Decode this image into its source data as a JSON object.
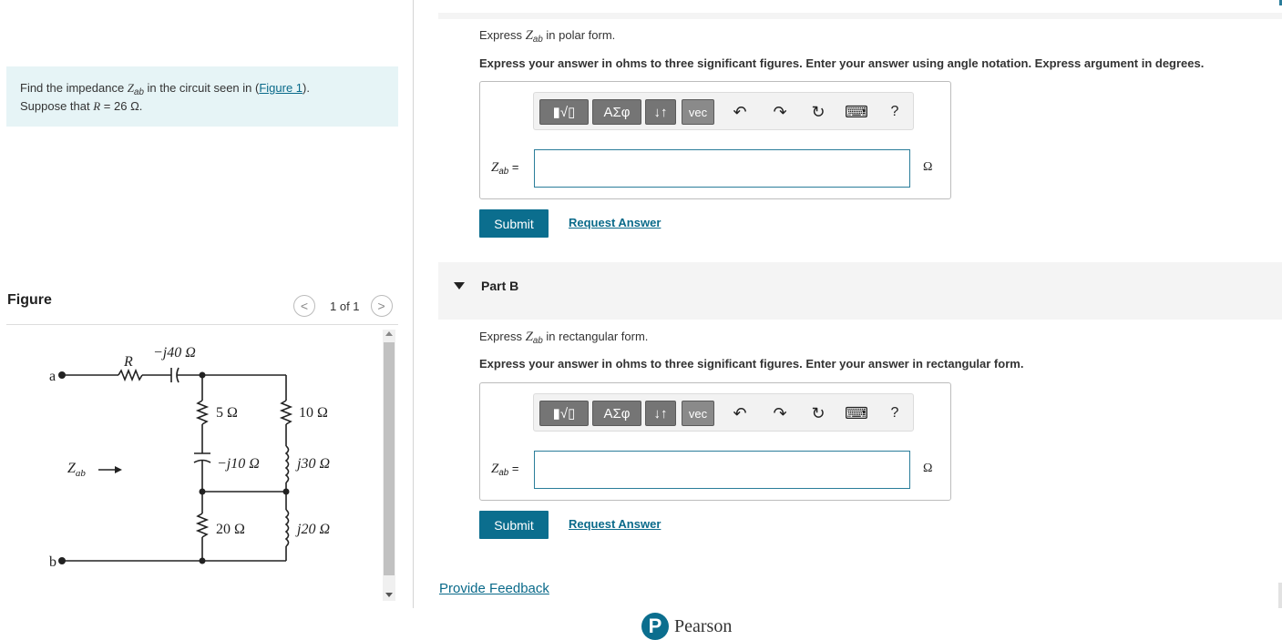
{
  "problem": {
    "text_before": "Find the impedance ",
    "z_symbol": "Z",
    "z_sub": "ab",
    "text_mid": " in the circuit seen in (",
    "figure_link": "Figure 1",
    "text_end": ").",
    "suppose": "Suppose that ",
    "r_symbol": "R",
    "r_value": " = 26 Ω."
  },
  "figure": {
    "title": "Figure",
    "pager": "1 of 1",
    "prev_glyph": "<",
    "next_glyph": ">",
    "labels": {
      "cap1": "−j40 Ω",
      "r": "R",
      "a": "a",
      "b": "b",
      "r5": "5 Ω",
      "r10": "10 Ω",
      "capj10": "−j10 Ω",
      "indj30": "j30 Ω",
      "zab": "Z",
      "zab_sub": "ab",
      "r20": "20 Ω",
      "indj20": "j20 Ω"
    }
  },
  "part_a": {
    "prompt_pre": "Express ",
    "z_symbol": "Z",
    "z_sub": "ab",
    "prompt_post": " in polar form.",
    "instructions": "Express your answer in ohms to three significant figures. Enter your answer using angle notation. Express argument in degrees.",
    "z_label_sym": "Z",
    "z_label_sub": "ab",
    "z_label_eq": " =",
    "input_value": "",
    "unit": "Ω",
    "submit": "Submit",
    "request": "Request Answer"
  },
  "part_b": {
    "title": "Part B",
    "prompt_pre": "Express ",
    "z_symbol": "Z",
    "z_sub": "ab",
    "prompt_post": " in rectangular form.",
    "instructions": "Express your answer in ohms to three significant figures. Enter your answer in rectangular form.",
    "z_label_sym": "Z",
    "z_label_sub": "ab",
    "z_label_eq": " =",
    "input_value": "",
    "unit": "Ω",
    "submit": "Submit",
    "request": "Request Answer"
  },
  "toolbar": {
    "templates": "▮√▯",
    "greek": "ΑΣφ",
    "updown": "↓↑",
    "vec": "vec",
    "undo": "↶",
    "redo": "↷",
    "reset": "↻",
    "keyboard": "⌨",
    "help": "?"
  },
  "footer": {
    "feedback": "Provide Feedback",
    "brand_letter": "P",
    "brand": "Pearson"
  }
}
